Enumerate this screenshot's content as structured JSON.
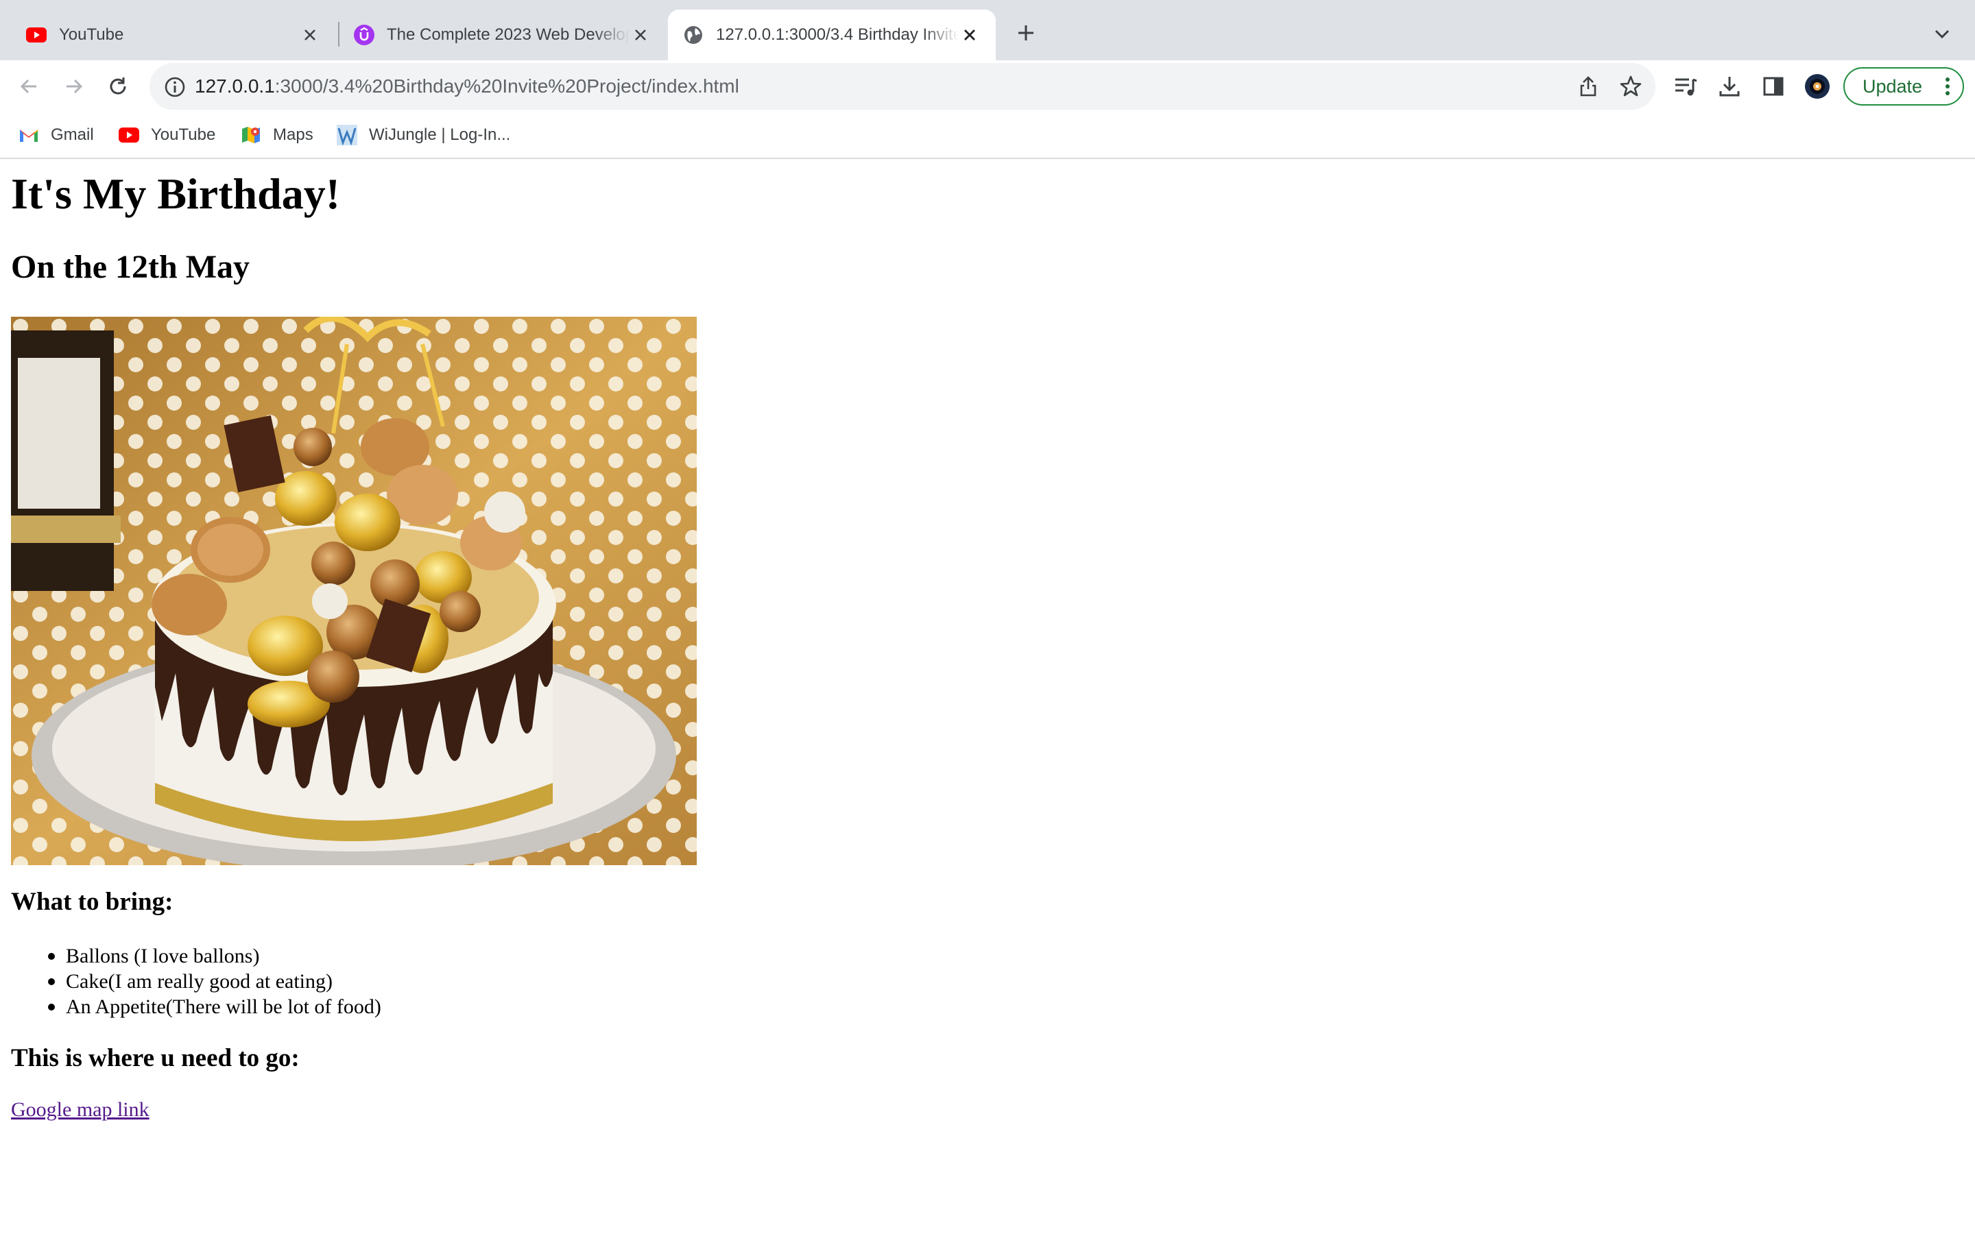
{
  "browser": {
    "tabs": [
      {
        "title": "YouTube",
        "icon": "youtube-icon",
        "active": false
      },
      {
        "title": "The Complete 2023 Web Development",
        "icon": "udemy-icon",
        "active": false
      },
      {
        "title": "127.0.0.1:3000/3.4 Birthday Invite",
        "icon": "globe-icon",
        "active": true
      }
    ],
    "address": {
      "host": "127.0.0.1",
      "path": ":3000/3.4%20Birthday%20Invite%20Project/index.html"
    },
    "update_label": "Update",
    "bookmarks": [
      {
        "label": "Gmail",
        "icon": "gmail-icon"
      },
      {
        "label": "YouTube",
        "icon": "youtube-icon"
      },
      {
        "label": "Maps",
        "icon": "maps-icon"
      },
      {
        "label": "WiJungle | Log-In...",
        "icon": "wijungle-icon"
      }
    ],
    "colors": {
      "tabstrip": "#dee1e6",
      "update_border": "#1e8e3e",
      "link_visited": "#551a8b"
    }
  },
  "page": {
    "heading": "It's My Birthday!",
    "date": "On the 12th May",
    "image_description_icon": "birthday-cake-photo",
    "bring_heading": "What to bring:",
    "bring_items": [
      "Ballons (I love ballons)",
      "Cake(I am really good at eating)",
      "An Appetite(There will be lot of food)"
    ],
    "where_heading": "This is where u need to go:",
    "map_link": "Google map link"
  }
}
